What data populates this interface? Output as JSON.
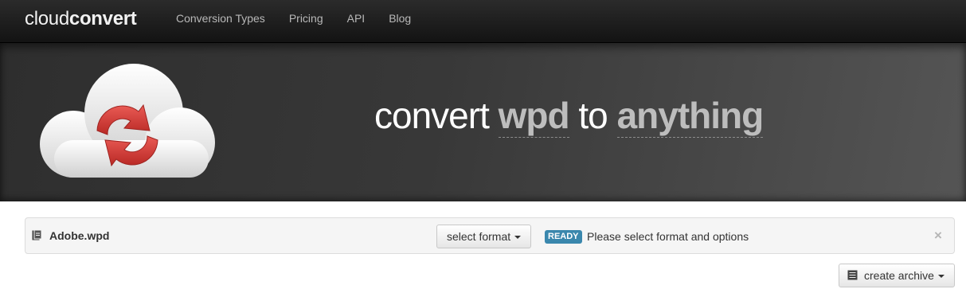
{
  "navbar": {
    "brand_light": "cloud",
    "brand_bold": "convert",
    "links": [
      "Conversion Types",
      "Pricing",
      "API",
      "Blog"
    ]
  },
  "hero": {
    "word1": "convert",
    "input_format": "wpd",
    "word2": "to",
    "output_format": "anything"
  },
  "file": {
    "name": "Adobe.wpd",
    "select_label": "select format",
    "status_badge": "READY",
    "status_message": "Please select format and options",
    "remove_icon": "×"
  },
  "actions": {
    "archive_label": "create archive"
  },
  "colors": {
    "nav_bg": "#1b1b1b",
    "accent_red": "#d63a35",
    "badge_blue": "#3a87ad"
  },
  "icons": [
    "sync-arrows-icon",
    "cloud-icon",
    "file-icon",
    "archive-icon",
    "close-icon",
    "caret-down-icon"
  ]
}
